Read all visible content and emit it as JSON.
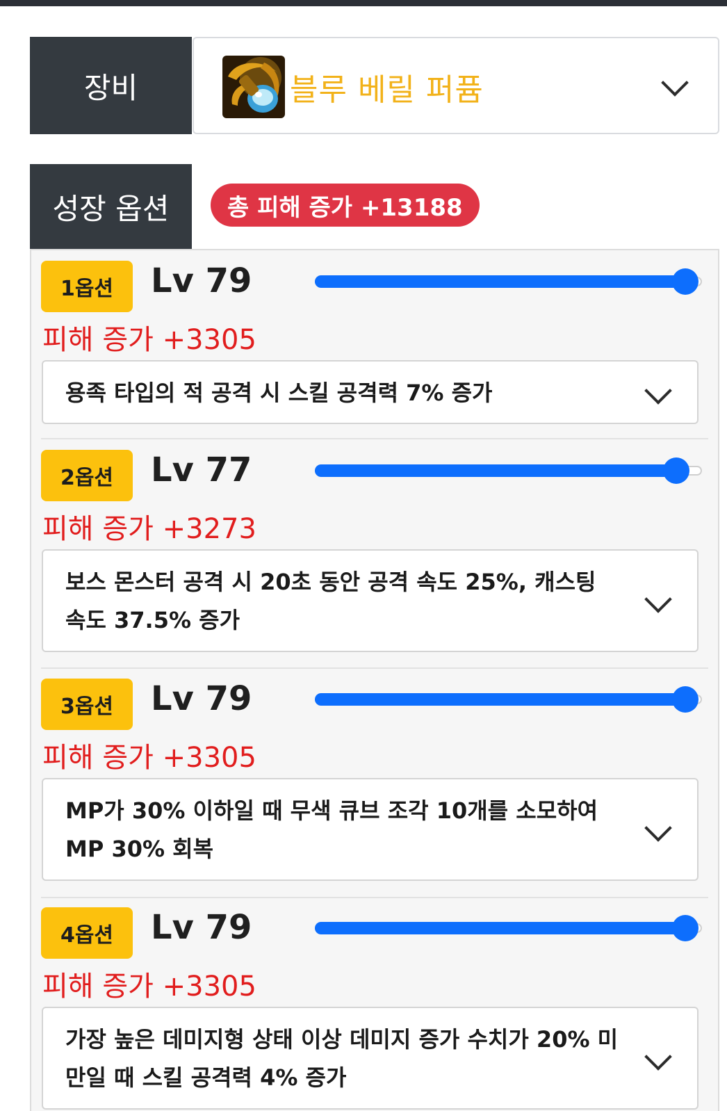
{
  "equipment": {
    "label": "장비",
    "selected_item": "블루 베릴 퍼퓸",
    "item_icon": "perfume-bottle-icon",
    "item_name_color": "#f2b21a"
  },
  "growth": {
    "label": "성장 옵션",
    "total_badge": "총 피해 증가 +13188",
    "badge_color": "#df3545"
  },
  "options": [
    {
      "badge": "1옵션",
      "level": "Lv 79",
      "slider_fraction": 0.96,
      "damage": "피해 증가 +3305",
      "description": "용족 타입의 적 공격 시 스킬 공격력 7% 증가"
    },
    {
      "badge": "2옵션",
      "level": "Lv 77",
      "slider_fraction": 0.936,
      "damage": "피해 증가 +3273",
      "description": "보스 몬스터 공격 시 20초 동안 공격 속도 25%, 캐스팅 속도 37.5% 증가"
    },
    {
      "badge": "3옵션",
      "level": "Lv 79",
      "slider_fraction": 0.96,
      "damage": "피해 증가 +3305",
      "description": "MP가 30% 이하일 때 무색 큐브 조각 10개를 소모하여 MP 30% 회복"
    },
    {
      "badge": "4옵션",
      "level": "Lv 79",
      "slider_fraction": 0.96,
      "damage": "피해 증가 +3305",
      "description": "가장 높은 데미지형 상태 이상 데미지 증가 수치가 20% 미만일 때 스킬 공격력 4% 증가"
    }
  ],
  "colors": {
    "label_bg": "#343a40",
    "option_badge": "#fcc10d",
    "slider": "#0d6efd",
    "damage_text": "#e11d1d"
  }
}
